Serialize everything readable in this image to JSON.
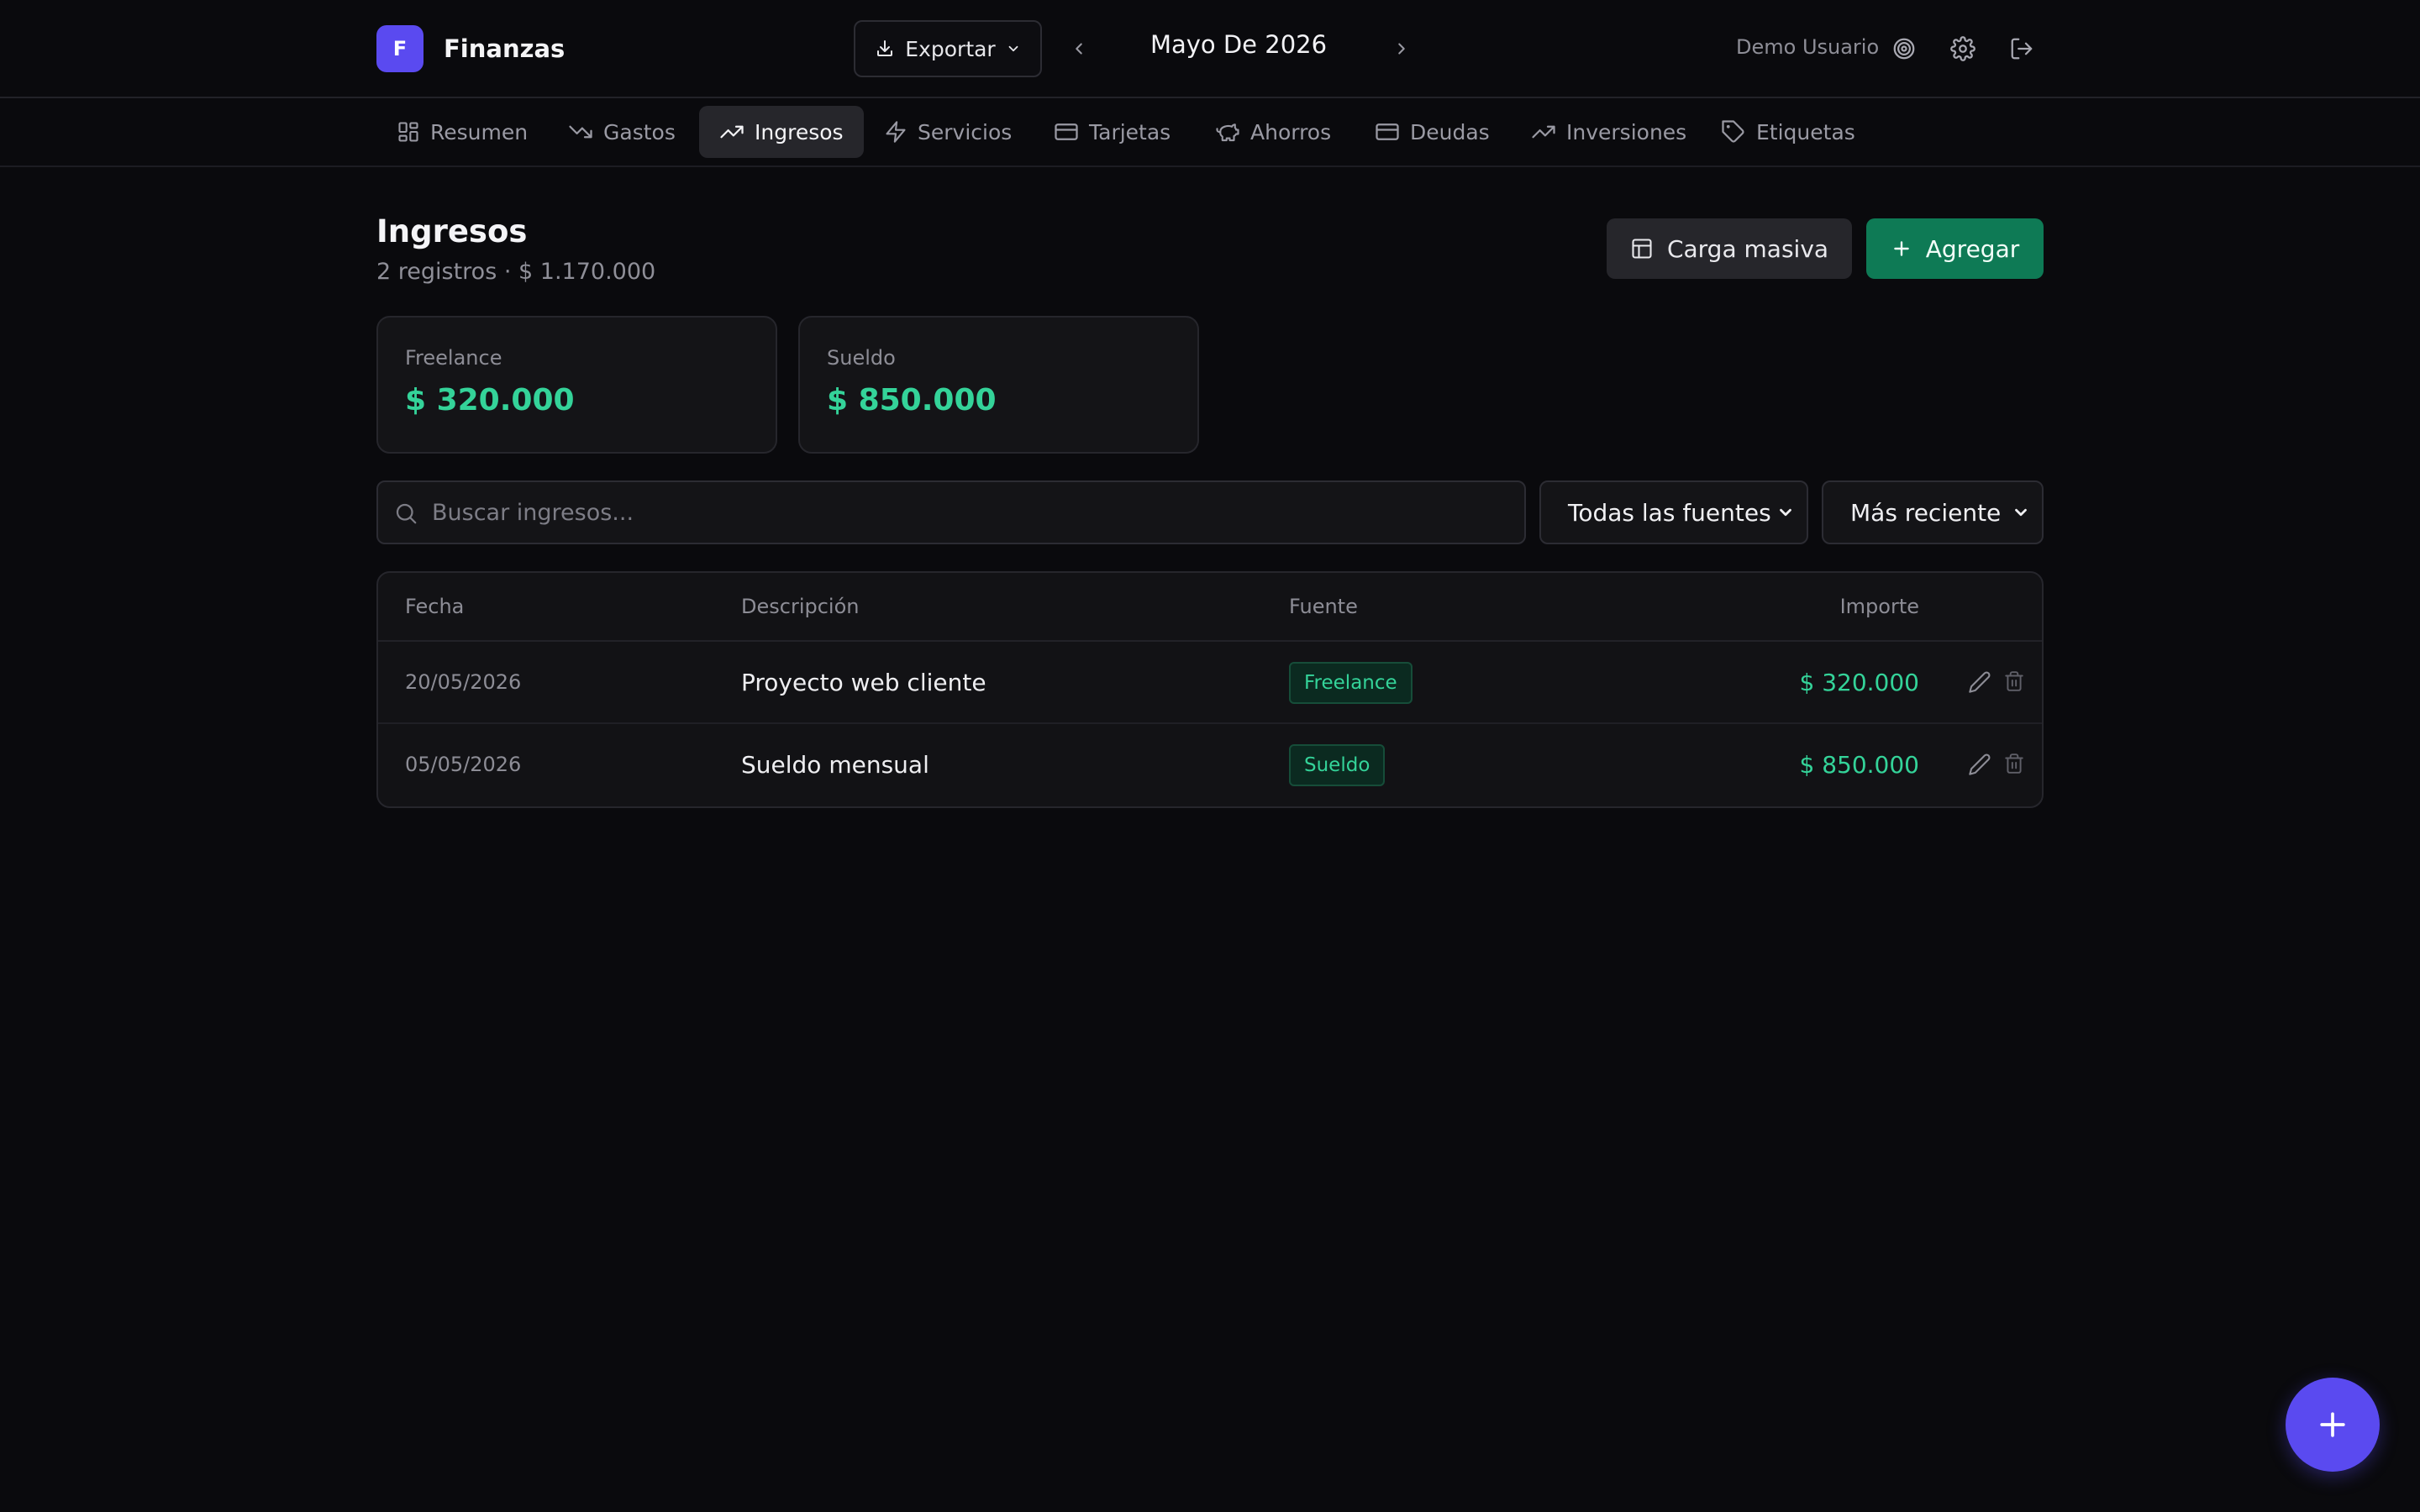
{
  "app": {
    "logo_letter": "F",
    "title": "Finanzas"
  },
  "header": {
    "export_label": "Exportar",
    "month_label": "Mayo De 2026",
    "user_name": "Demo Usuario"
  },
  "nav": {
    "tabs": [
      {
        "label": "Resumen",
        "icon": "grid-icon"
      },
      {
        "label": "Gastos",
        "icon": "trending-down-icon"
      },
      {
        "label": "Ingresos",
        "icon": "trending-up-icon",
        "active": true
      },
      {
        "label": "Servicios",
        "icon": "bolt-icon"
      },
      {
        "label": "Tarjetas",
        "icon": "credit-card-icon"
      },
      {
        "label": "Ahorros",
        "icon": "piggy-bank-icon"
      },
      {
        "label": "Deudas",
        "icon": "wallet-card-icon"
      },
      {
        "label": "Inversiones",
        "icon": "trending-up-icon"
      },
      {
        "label": "Etiquetas",
        "icon": "tag-icon"
      }
    ]
  },
  "page": {
    "title": "Ingresos",
    "subtitle": "2 registros · $ 1.170.000",
    "bulk_label": "Carga masiva",
    "add_label": "Agregar"
  },
  "summary_cards": [
    {
      "label": "Freelance",
      "value": "$ 320.000"
    },
    {
      "label": "Sueldo",
      "value": "$ 850.000"
    }
  ],
  "filters": {
    "search_placeholder": "Buscar ingresos...",
    "source_selected": "Todas las fuentes",
    "sort_selected": "Más reciente"
  },
  "table": {
    "headers": {
      "date": "Fecha",
      "description": "Descripción",
      "source": "Fuente",
      "amount": "Importe"
    },
    "rows": [
      {
        "date": "20/05/2026",
        "description": "Proyecto web cliente",
        "source": "Freelance",
        "amount": "$ 320.000"
      },
      {
        "date": "05/05/2026",
        "description": "Sueldo mensual",
        "source": "Sueldo",
        "amount": "$ 850.000"
      }
    ]
  },
  "colors": {
    "accent": "#5a4af0",
    "positive": "#34d399",
    "add_button": "#0e7a55",
    "background": "#0a0a0d"
  }
}
